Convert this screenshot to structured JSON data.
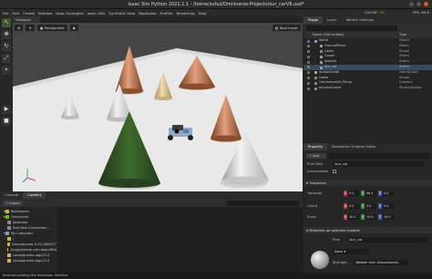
{
  "window": {
    "title": "Isaac Sim Python 2022.1.1 - /home/suhui/Omniverse-Projects/our_carV6.usd*"
  },
  "menu": {
    "items": [
      "File",
      "Edit",
      "Create",
      "Window",
      "Isaac Examples",
      "Isaac Utils",
      "Synthetic Data",
      "Replicator",
      "Profiler",
      "Rendering",
      "Help"
    ],
    "cache_label": "CACHE:",
    "cache_status": "ON",
    "fps": "FPS: 64.8"
  },
  "viewport": {
    "tab": "Viewport",
    "camera": "Perspective",
    "layer": "Root Layer"
  },
  "content": {
    "tabs": [
      "Console",
      "Content"
    ],
    "import_label": "Import",
    "tree": [
      {
        "label": "Bookmarks",
        "color": "#d4b24a",
        "indent": 1
      },
      {
        "label": "Omniverse",
        "color": "#76b900",
        "indent": 1
      },
      {
        "label": "localhost",
        "color": "#888888",
        "indent": 2
      },
      {
        "label": "Add New Connection ...",
        "color": "#888888",
        "indent": 2
      },
      {
        "label": "My Computer",
        "color": "#7aa0c8",
        "indent": 1
      },
      {
        "label": "/",
        "color": "#d4b24a",
        "indent": 2
      },
      {
        "label": "/snap/gnome-3-34-1804/77",
        "color": "#d4b24a",
        "indent": 2
      },
      {
        "label": "/snap/gnome-calculator/884",
        "color": "#d4b24a",
        "indent": 2
      },
      {
        "label": "/snap/gnome-logs/112",
        "color": "#d4b24a",
        "indent": 2
      },
      {
        "label": "/snap/gnome-logs/115",
        "color": "#d4b24a",
        "indent": 2
      }
    ]
  },
  "status": {
    "text": "finished building the extension timeline"
  },
  "stage": {
    "tabs": [
      "Stage",
      "Layer",
      "Render Settings"
    ],
    "columns": {
      "name": "Name (Old to New)",
      "type": "Type"
    },
    "items": [
      {
        "name": "World",
        "type": "Xform",
        "indent": 1,
        "color": "#7aa0c8",
        "selected": false
      },
      {
        "name": "GroundPlane",
        "type": "Xform",
        "indent": 2,
        "color": "#7aa0c8",
        "selected": false
      },
      {
        "name": "Looks",
        "type": "Scope",
        "indent": 2,
        "color": "#888888",
        "selected": false
      },
      {
        "name": "Cones",
        "type": "Xform",
        "indent": 2,
        "color": "#7aa0c8",
        "selected": false
      },
      {
        "name": "objects",
        "type": "Xform",
        "indent": 2,
        "color": "#7aa0c8",
        "selected": false
      },
      {
        "name": "our_car",
        "type": "Xform",
        "indent": 2,
        "color": "#7aa0c8",
        "selected": true
      },
      {
        "name": "ActionGraph",
        "type": "OmniGraph",
        "indent": 1,
        "color": "#c8a04a",
        "selected": false
      },
      {
        "name": "Looks",
        "type": "Scope",
        "indent": 1,
        "color": "#888888",
        "selected": false
      },
      {
        "name": "OmniverseKit_Persp",
        "type": "Camera",
        "indent": 1,
        "color": "#888888",
        "selected": false
      },
      {
        "name": "physicsScene",
        "type": "PhysicsScene",
        "indent": 1,
        "color": "#888888",
        "selected": false
      }
    ]
  },
  "property": {
    "tabs": [
      "Property",
      "Semantics Schema Editor"
    ],
    "add_label": "Add",
    "prim_path_label": "Prim Path",
    "prim_path": "/our_car",
    "instanceable_label": "Instanceable",
    "transform_label": "Transform",
    "translate_label": "Translate",
    "orient_label": "Orient",
    "scale_label": "Scale",
    "translate": [
      "0.0",
      "46.4",
      "0.0"
    ],
    "orient": [
      "0.0",
      "0.0",
      "0.0"
    ],
    "scale": [
      "10.0",
      "10.0",
      "10.0"
    ],
    "material_label": "Materials on selected models",
    "material_prim_label": "Prim",
    "material_prim": "/our_car",
    "material_value": "None",
    "strength_label": "Strength",
    "strength_value": "Weaker than Descendants"
  }
}
